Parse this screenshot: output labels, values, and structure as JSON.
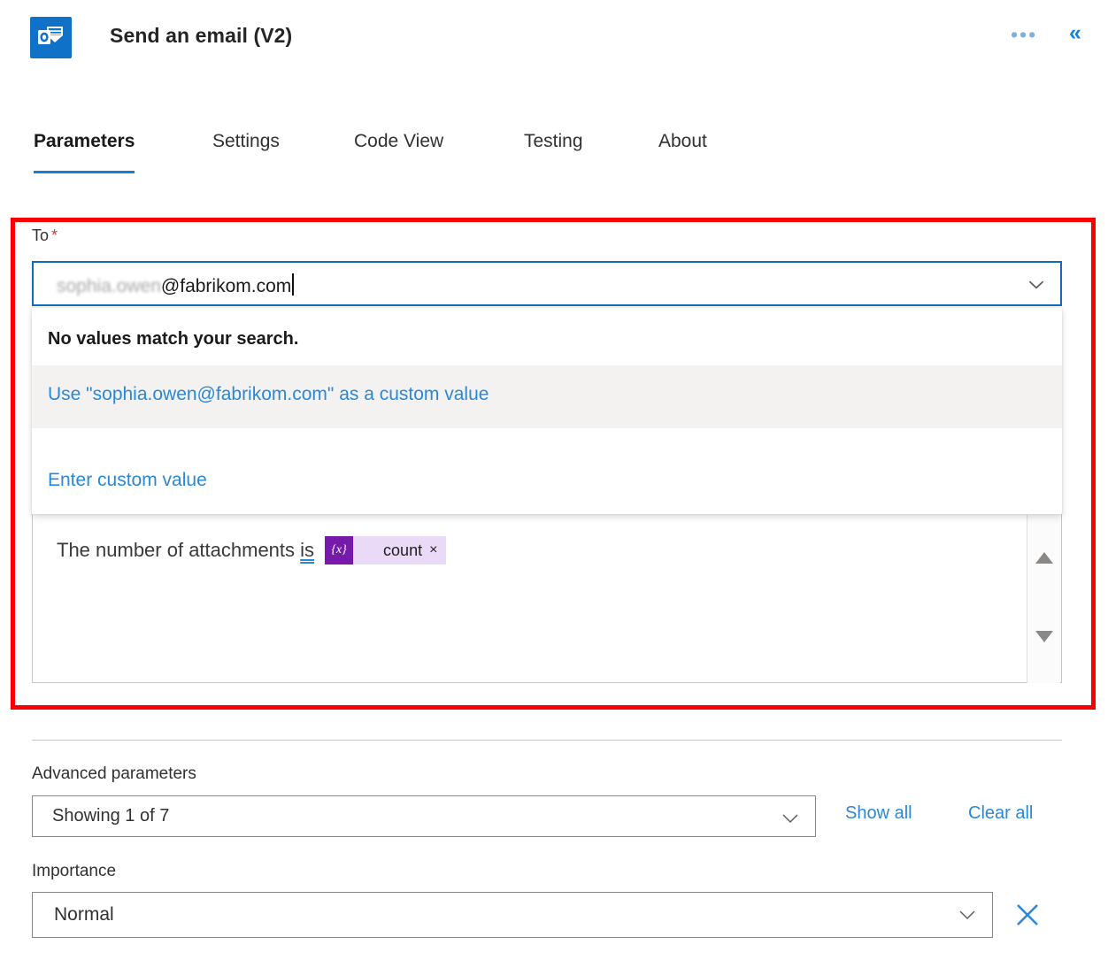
{
  "header": {
    "title": "Send an email (V2)",
    "app_icon": "outlook-icon",
    "accent_color": "#0f71c8",
    "more_label": "•••",
    "collapse_label": "«"
  },
  "tabs": [
    {
      "label": "Parameters",
      "active": true
    },
    {
      "label": "Settings",
      "active": false
    },
    {
      "label": "Code View",
      "active": false
    },
    {
      "label": "Testing",
      "active": false
    },
    {
      "label": "About",
      "active": false
    }
  ],
  "to_field": {
    "label": "To",
    "required_marker": "*",
    "value_redacted": "sophia.owen",
    "value_visible": "@fabrikom.com",
    "focus_color": "#0f6cbd"
  },
  "dropdown": {
    "no_match_text": "No values match your search.",
    "items": [
      {
        "label": "Use \"sophia.owen@fabrikom.com\" as a custom value",
        "highlighted": true
      },
      {
        "label": "Enter custom value",
        "highlighted": false
      }
    ],
    "link_color": "#2b88d8"
  },
  "body_editor": {
    "text": "The number of attachments",
    "spellchecked_word": "is",
    "token": {
      "icon_label": "{x}",
      "label": "count",
      "close_label": "×",
      "icon_color": "#7719aa",
      "chip_color": "#ead9f7"
    },
    "scroll_up": "▲",
    "scroll_down": "▼"
  },
  "advanced": {
    "label": "Advanced parameters",
    "selected": "Showing 1 of 7",
    "show_all_label": "Show all",
    "clear_all_label": "Clear all"
  },
  "importance": {
    "label": "Importance",
    "selected": "Normal",
    "clear_label": "✕",
    "clear_color": "#2b88d8"
  },
  "highlight": {
    "color": "#f90000"
  }
}
